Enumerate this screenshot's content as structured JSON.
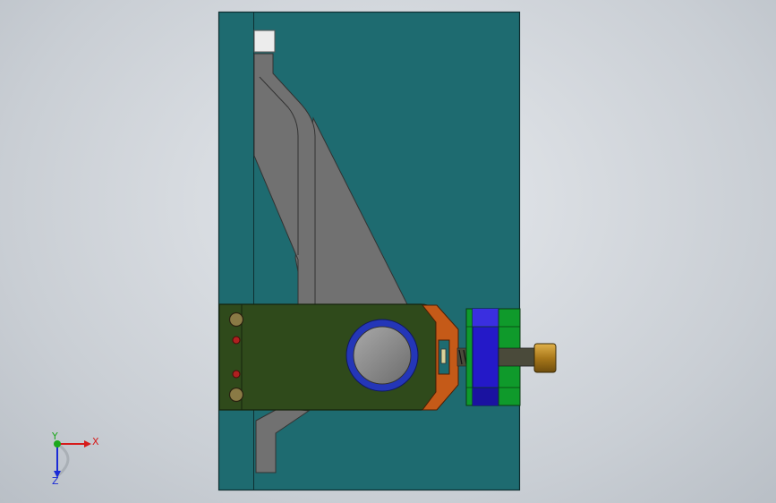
{
  "viewport": {
    "background": "#d3d8dd"
  },
  "model": {
    "colors": {
      "plate": "#1e6b70",
      "plate_edge": "#0e2e31",
      "cam_body": "#717171",
      "cam_edge": "#333333",
      "block": "#2f4a1b",
      "bush_ring": "#2436b8",
      "bush_inner": "#8a8a8a",
      "clamp": "#c55a18",
      "nut": "#0f9a2b",
      "nut_face": "#2419c8",
      "spring": "#4a4a3a",
      "cap": "#b88a1e",
      "hole": "#8a7a45",
      "pin": "#b02020",
      "insert": "#ececec"
    }
  },
  "triad": {
    "x_label": "X",
    "y_label": "Y",
    "z_label": "Z",
    "x_color": "#d61b1b",
    "y_color": "#1ca81c",
    "z_color": "#1b2bd6"
  }
}
